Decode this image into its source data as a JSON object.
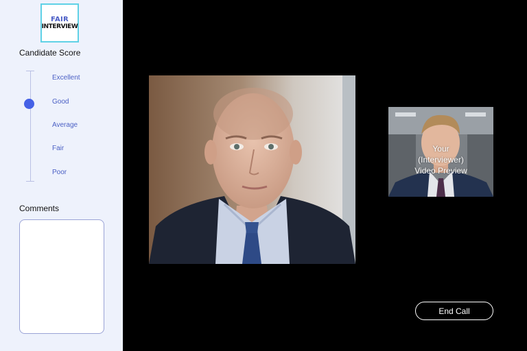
{
  "logo": {
    "line1": "FAIR",
    "line2": "INTERVIEW"
  },
  "sidebar": {
    "score_title": "Candidate Score",
    "score_options": [
      "Excellent",
      "Good",
      "Average",
      "Fair",
      "Poor"
    ],
    "selected_score": "Good",
    "comments_title": "Comments",
    "comments_value": ""
  },
  "video": {
    "preview_label": "Your\n(Interviewer)\nVideo Preview"
  },
  "controls": {
    "end_call_label": "End Call"
  },
  "colors": {
    "sidebar_bg": "#eef2fc",
    "accent": "#4561e6",
    "option_text": "#4a5fc4",
    "stage_bg": "#000000"
  }
}
